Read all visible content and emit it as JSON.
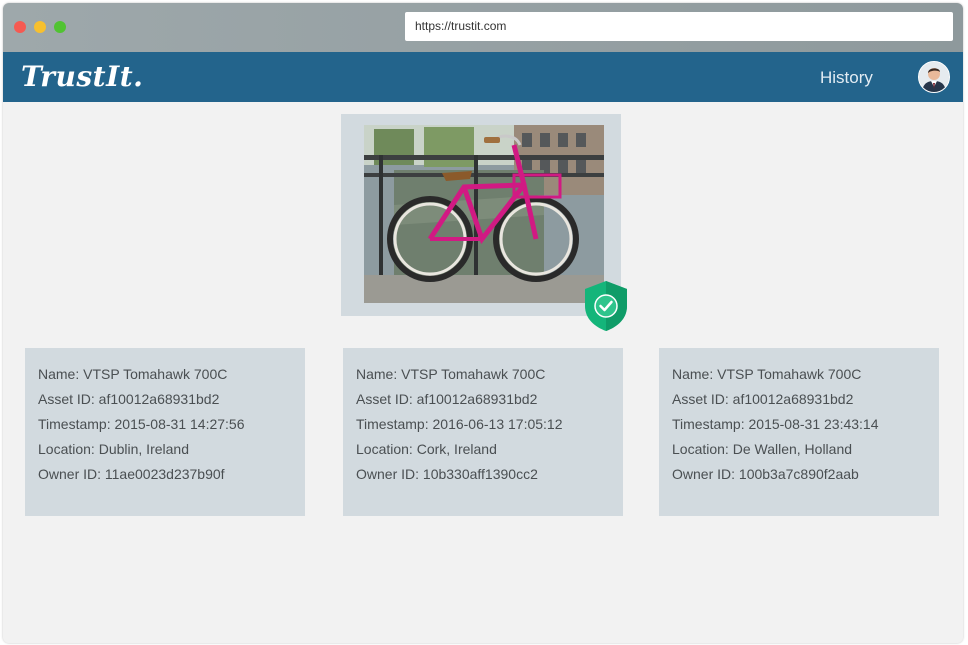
{
  "browser": {
    "url": "https://trustit.com"
  },
  "navbar": {
    "logo": "TrustIt.",
    "history_label": "History",
    "avatar_icon": "user-avatar"
  },
  "asset_image": {
    "subject": "pink bicycle",
    "verified_icon": "verified-shield-check-icon",
    "verified_color": "#14b57a"
  },
  "colors": {
    "navbar": "#23648c",
    "card_bg": "#d2dadf",
    "page_bg": "#f2f2f2"
  },
  "records": [
    {
      "name": "Name: VTSP Tomahawk 700C",
      "asset_id": "Asset ID: af10012a68931bd2",
      "timestamp": "Timestamp: 2015-08-31 14:27:56",
      "location": "Location: Dublin, Ireland",
      "owner_id": "Owner ID: 11ae0023d237b90f"
    },
    {
      "name": "Name: VTSP Tomahawk 700C",
      "asset_id": "Asset ID: af10012a68931bd2",
      "timestamp": "Timestamp: 2016-06-13 17:05:12",
      "location": "Location: Cork, Ireland",
      "owner_id": "Owner ID: 10b330aff1390cc2"
    },
    {
      "name": "Name: VTSP Tomahawk 700C",
      "asset_id": "Asset ID: af10012a68931bd2",
      "timestamp": "Timestamp: 2015-08-31 23:43:14",
      "location": "Location: De Wallen, Holland",
      "owner_id": "Owner ID: 100b3a7c890f2aab"
    }
  ]
}
